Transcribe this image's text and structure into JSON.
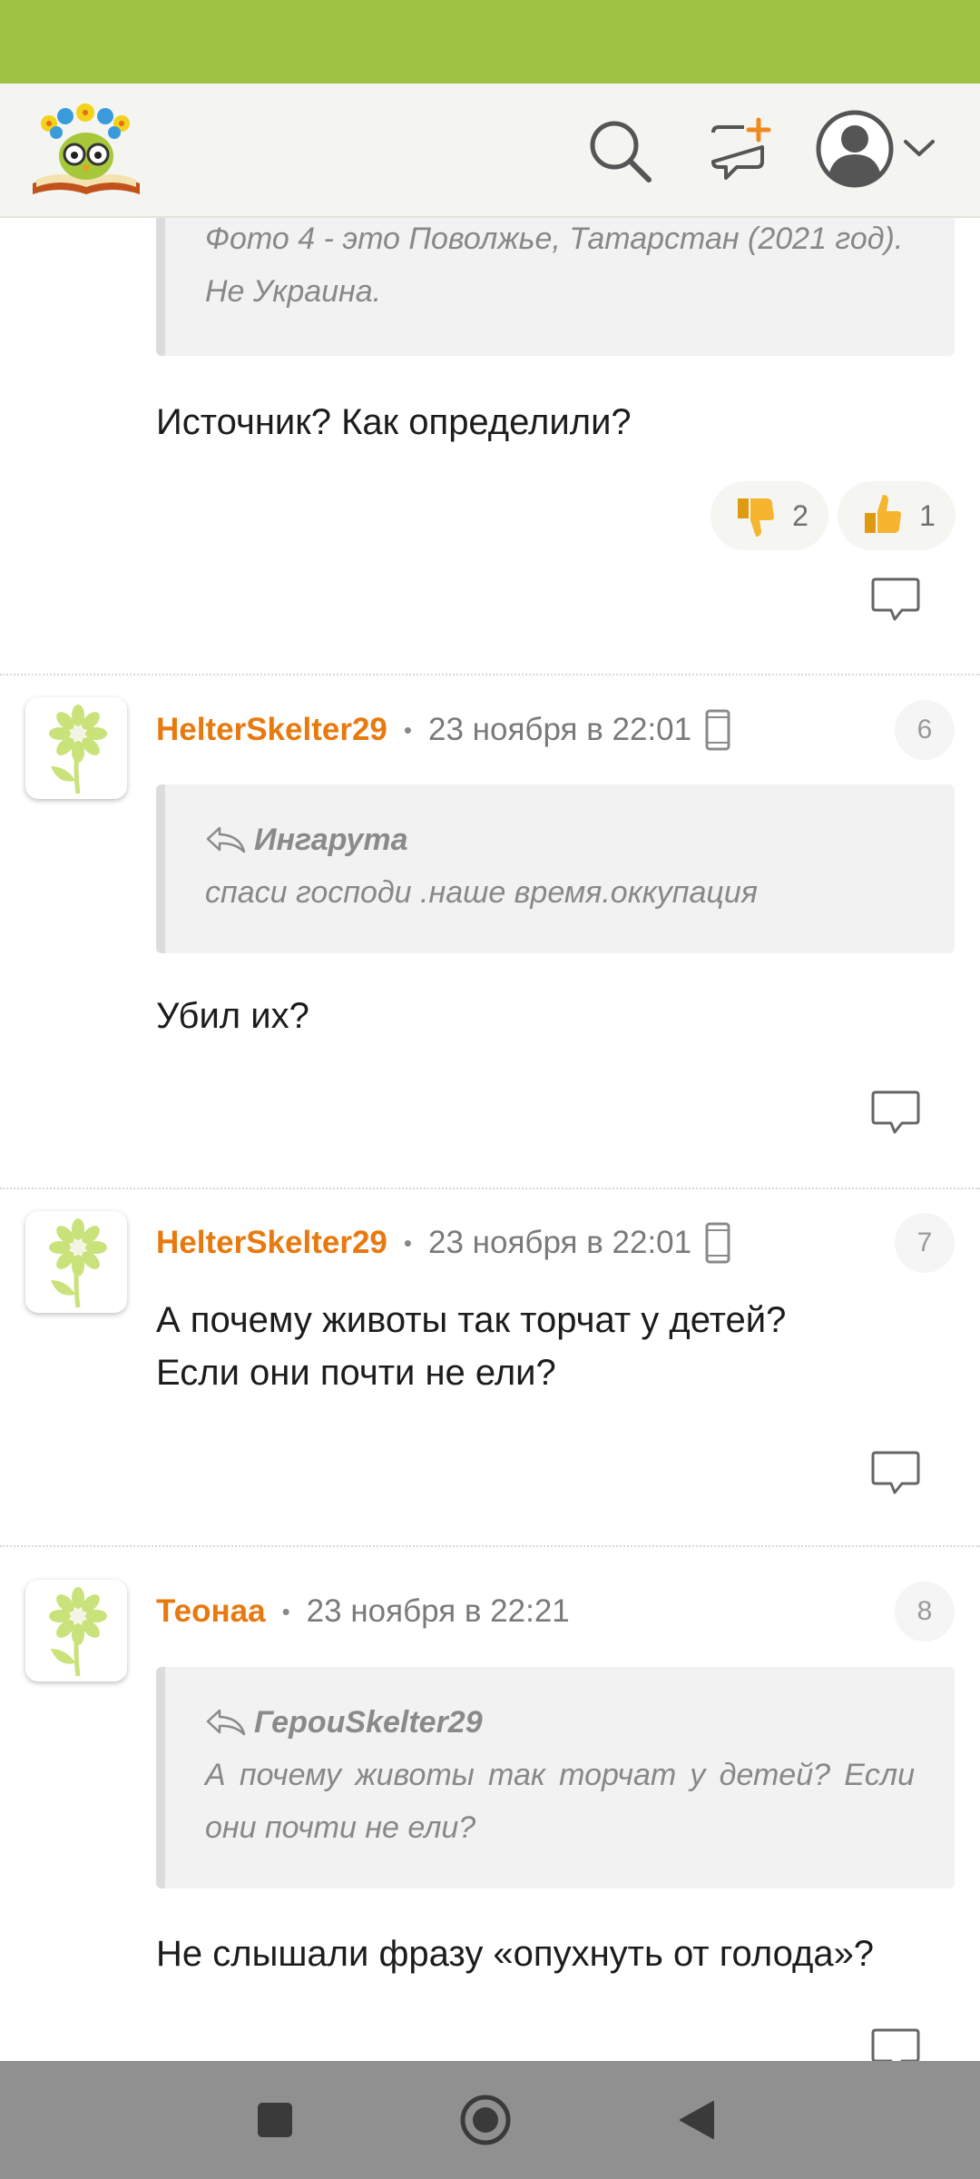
{
  "header": {
    "logo_icon": "owl-book-logo",
    "icons": [
      "search-icon",
      "new-post-icon",
      "account-avatar-icon",
      "chevron-down-icon"
    ],
    "brand_color": "#9dc244"
  },
  "comments": [
    {
      "quote_text": "Фото 4 - это Поволжье, Татарстан (2021 год). Не Украина.",
      "text": "Источник? Как определили?",
      "reactions": {
        "dislike_count": "2",
        "like_count": "1"
      }
    },
    {
      "number": "6",
      "username": "HelterSkelter29",
      "date": "23 ноября в 22:01",
      "quote_author": "Ингарута",
      "quote_text": "спаси господи .наше время.оккупация",
      "text": "Убил их?"
    },
    {
      "number": "7",
      "username": "HelterSkelter29",
      "date": "23 ноября в 22:01",
      "text_line1": "А почему животы так торчат у детей?",
      "text_line2": "Если они почти не ели?"
    },
    {
      "number": "8",
      "username": "Теонаа",
      "date": "23 ноября в 22:21",
      "quote_author": "ГероиSkelter29",
      "quote_text": "А почему животы так торчат у детей? Если они почти не ели?",
      "text": "Не слышали фразу «опухнуть от голода»?"
    }
  ],
  "colors": {
    "username": "#e8790f",
    "quote_bg": "#f2f2f2"
  },
  "navbar": {
    "icons": [
      "recents-square-icon",
      "home-circle-icon",
      "back-triangle-icon"
    ]
  }
}
